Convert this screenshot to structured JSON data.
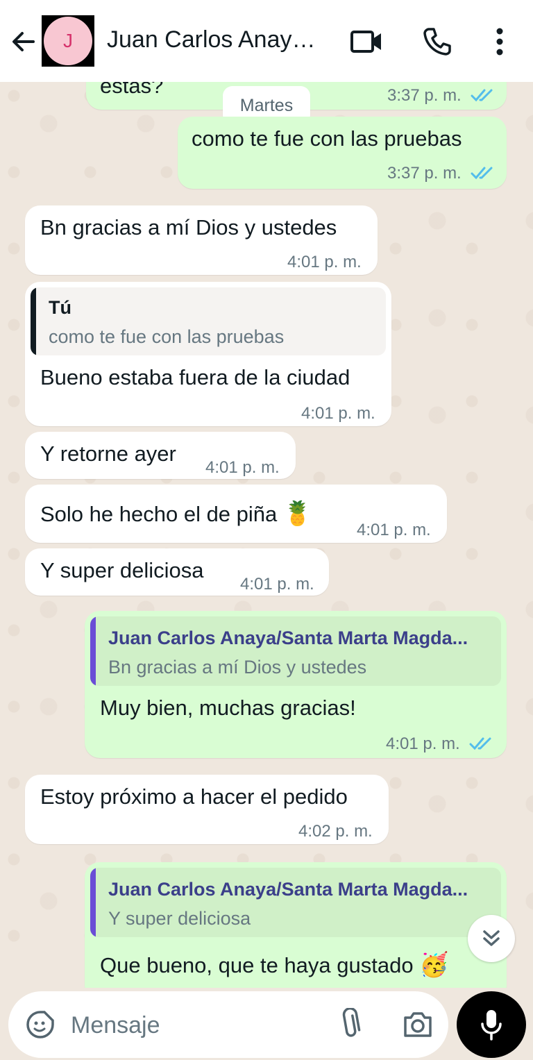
{
  "header": {
    "avatar_initial": "J",
    "contact_name": "Juan Carlos Anaya/Santa Marta Magdalena"
  },
  "chat": {
    "date_chip": "Martes",
    "messages": [
      {
        "dir": "out",
        "text": "estas?",
        "time": "3:37 p. m.",
        "read": true
      },
      {
        "dir": "out",
        "text": "como te fue con las pruebas",
        "time": "3:37 p. m.",
        "read": true
      },
      {
        "dir": "in",
        "text": "Bn gracias a mí Dios y ustedes",
        "time": "4:01 p. m."
      },
      {
        "dir": "in",
        "quote_author": "Tú",
        "quote_text": "como te fue con las pruebas",
        "text": "Bueno estaba fuera de la ciudad",
        "time": "4:01 p. m."
      },
      {
        "dir": "in",
        "text": "Y retorne ayer",
        "time": "4:01 p. m."
      },
      {
        "dir": "in",
        "text": "Solo he hecho el de piña",
        "emoji": "🍍",
        "time": "4:01 p. m."
      },
      {
        "dir": "in",
        "text": "Y super deliciosa",
        "time": "4:01 p. m."
      },
      {
        "dir": "out",
        "quote_author": "Juan Carlos Anaya/Santa Marta Magda...",
        "quote_text": "Bn gracias a mí Dios y ustedes",
        "text": "Muy bien, muchas gracias!",
        "time": "4:01 p. m.",
        "read": true
      },
      {
        "dir": "in",
        "text": "Estoy próximo a hacer el pedido",
        "time": "4:02 p. m."
      },
      {
        "dir": "out",
        "quote_author": "Juan Carlos Anaya/Santa Marta Magda...",
        "quote_text": "Y super deliciosa",
        "text": "Que bueno, que te haya gustado",
        "emoji": "🥳"
      }
    ]
  },
  "input": {
    "placeholder": "Mensaje"
  },
  "colors": {
    "incoming": "#ffffff",
    "outgoing": "#d9fdd3",
    "tick_blue": "#53bdeb",
    "quote_bar_in": "#111b21",
    "quote_bar_out": "#6a4dd6"
  }
}
